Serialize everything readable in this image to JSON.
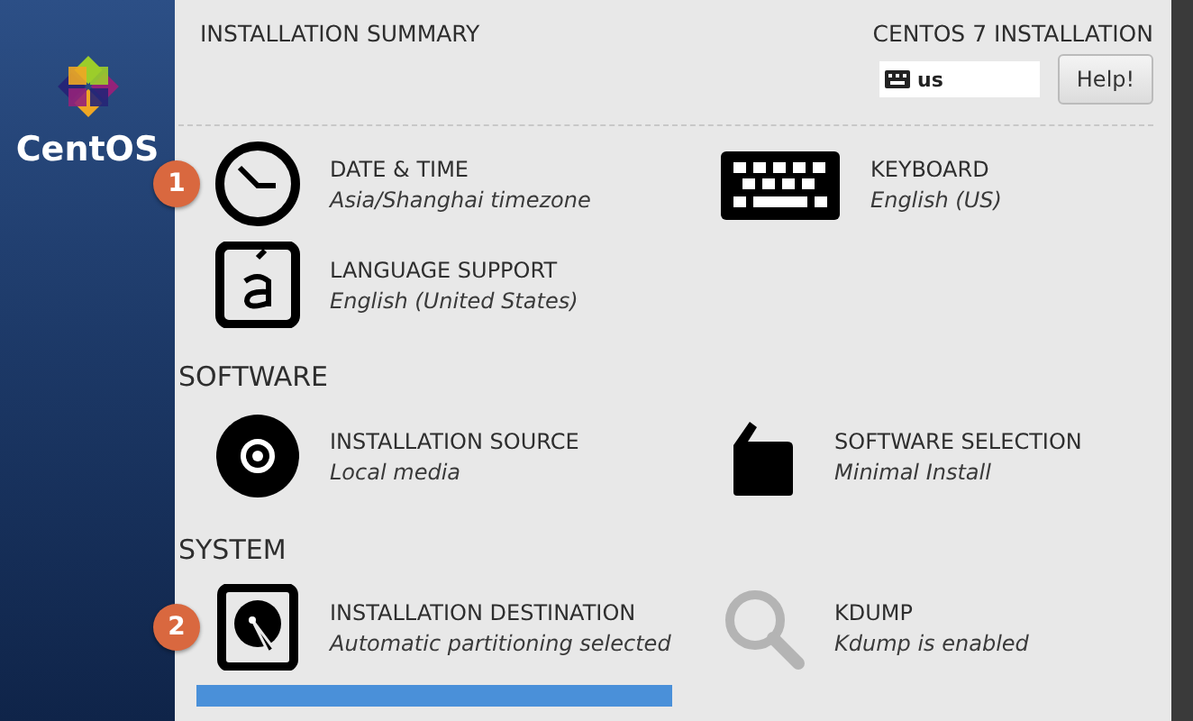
{
  "sidebar": {
    "logo_text": "CentOS"
  },
  "header": {
    "title": "INSTALLATION SUMMARY",
    "product": "CENTOS 7 INSTALLATION",
    "keyboard_layout": "us",
    "help_button": "Help!"
  },
  "localization": {
    "items": [
      {
        "kind": "clock",
        "title": "DATE & TIME",
        "status": "Asia/Shanghai timezone",
        "badge": "1",
        "dimmed": false
      },
      {
        "kind": "keyboard",
        "title": "KEYBOARD",
        "status": "English (US)",
        "dimmed": false
      },
      {
        "kind": "language",
        "title": "LANGUAGE SUPPORT",
        "status": "English (United States)",
        "dimmed": false
      }
    ]
  },
  "software": {
    "heading": "SOFTWARE",
    "items": [
      {
        "kind": "disc",
        "title": "INSTALLATION SOURCE",
        "status": "Local media",
        "dimmed": false
      },
      {
        "kind": "package",
        "title": "SOFTWARE SELECTION",
        "status": "Minimal Install",
        "dimmed": false
      }
    ]
  },
  "system": {
    "heading": "SYSTEM",
    "items": [
      {
        "kind": "disk",
        "title": "INSTALLATION DESTINATION",
        "status": "Automatic partitioning selected",
        "badge": "2",
        "dimmed": false
      },
      {
        "kind": "search",
        "title": "KDUMP",
        "status": "Kdump is enabled",
        "dimmed": true
      }
    ],
    "next_row_selected": true
  }
}
